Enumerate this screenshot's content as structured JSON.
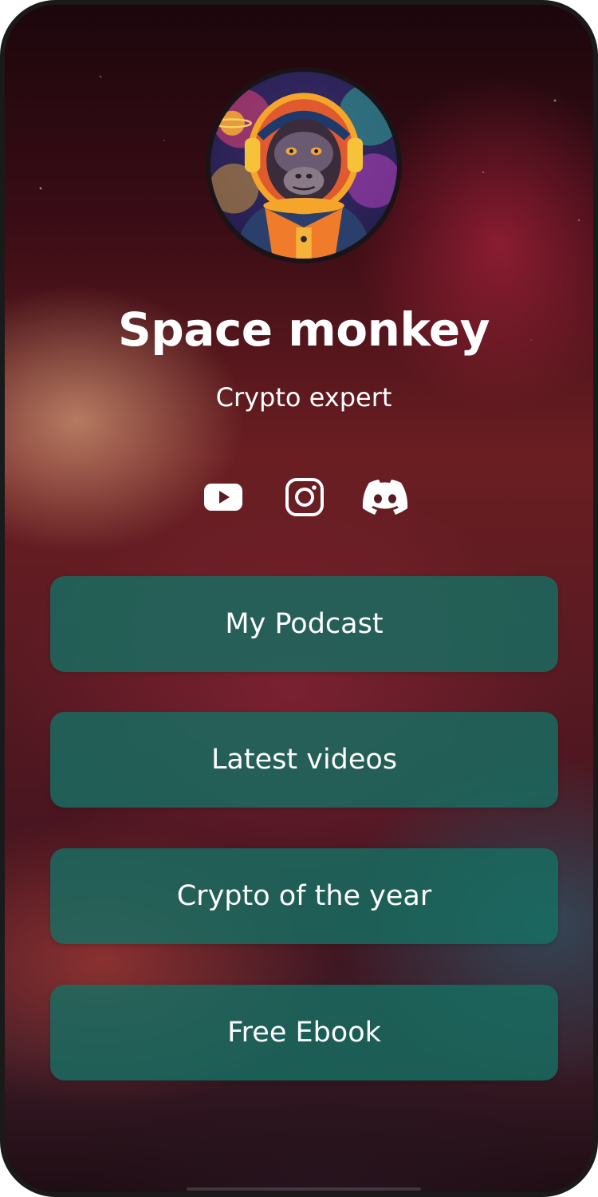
{
  "profile": {
    "name": "Space monkey",
    "tagline": "Crypto expert"
  },
  "socials": [
    {
      "icon": "youtube-icon"
    },
    {
      "icon": "instagram-icon"
    },
    {
      "icon": "discord-icon"
    }
  ],
  "links": [
    {
      "label": "My Podcast"
    },
    {
      "label": "Latest videos"
    },
    {
      "label": "Crypto of the year"
    },
    {
      "label": "Free Ebook"
    }
  ],
  "colors": {
    "button_bg": "#166e62",
    "text": "#ffffff",
    "frame": "#1a1a1a"
  }
}
